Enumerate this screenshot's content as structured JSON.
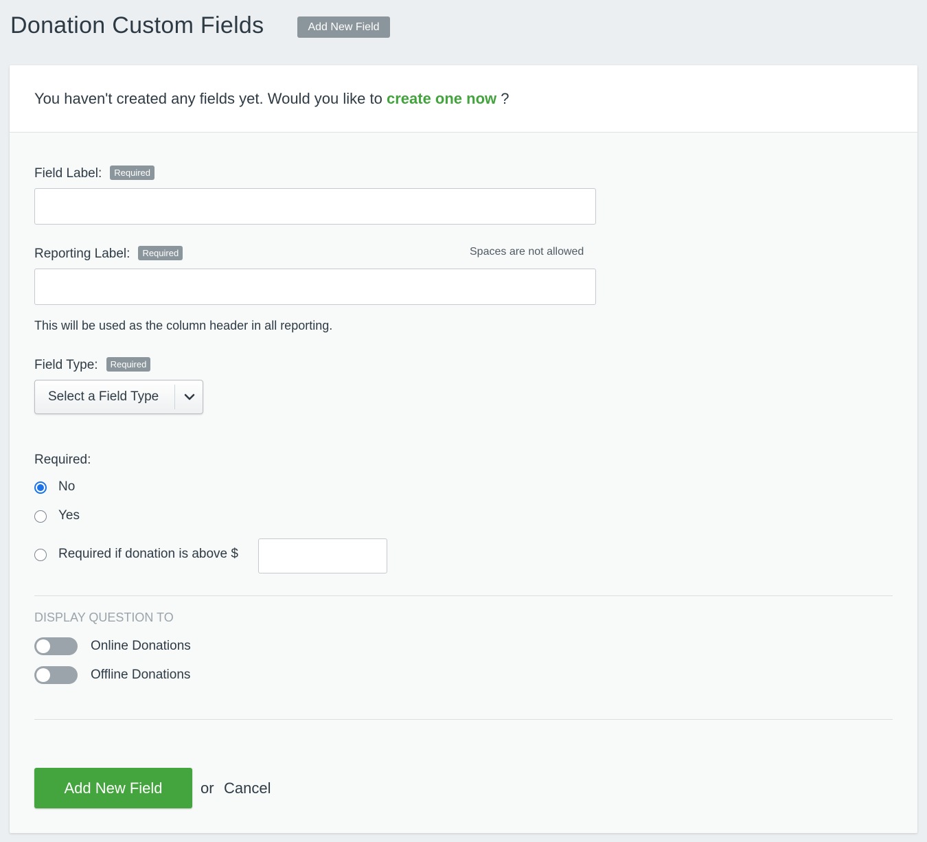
{
  "header": {
    "title": "Donation Custom Fields",
    "add_button_label": "Add New Field"
  },
  "notice": {
    "text_before": "You haven't created any fields yet. Would you like to ",
    "link_text": "create one now",
    "text_after": " ?"
  },
  "form": {
    "field_label": {
      "label": "Field Label:",
      "badge": "Required",
      "value": "",
      "placeholder": ""
    },
    "reporting_label": {
      "label": "Reporting Label:",
      "badge": "Required",
      "hint": "Spaces are not allowed",
      "value": "",
      "placeholder": "",
      "help_text": "This will be used as the column header in all reporting."
    },
    "field_type": {
      "label": "Field Type:",
      "badge": "Required",
      "selected": "Select a Field Type",
      "icon": "chevron-down-icon"
    },
    "required": {
      "label": "Required:",
      "options": [
        {
          "label": "No",
          "checked": true
        },
        {
          "label": "Yes",
          "checked": false
        },
        {
          "label": "Required if donation is above $",
          "checked": false
        }
      ],
      "amount_value": ""
    },
    "display": {
      "heading": "DISPLAY QUESTION TO",
      "toggles": [
        {
          "label": "Online Donations",
          "on": false
        },
        {
          "label": "Offline Donations",
          "on": false
        }
      ]
    },
    "actions": {
      "submit_label": "Add New Field",
      "or_text": "or",
      "cancel_label": "Cancel"
    }
  },
  "colors": {
    "primary_green": "#44a43d",
    "link_green": "#43a33c",
    "badge_gray": "#8a959c",
    "radio_blue": "#1a73e8",
    "background": "#eceff1"
  }
}
